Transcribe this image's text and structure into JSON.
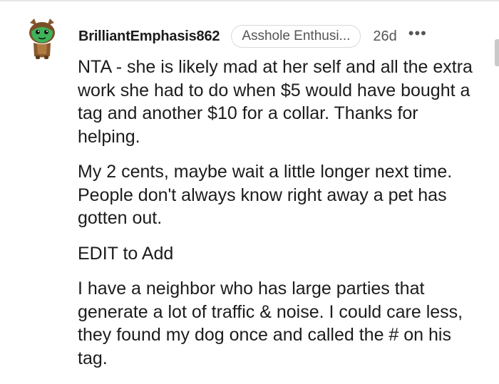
{
  "comment": {
    "author": "BrilliantEmphasis862",
    "flair": "Asshole Enthusi...",
    "age": "26d",
    "more_icon": "more-dots-icon",
    "avatar_icon": "snoo-avatar-icon",
    "paragraphs": [
      "NTA - she is likely mad at her self and all the extra work she had to do when $5 would have bought a tag and another $10 for a collar. Thanks for helping.",
      "My 2 cents, maybe wait a little longer next time. People don't always know right away a pet has gotten out.",
      "EDIT to Add",
      "I have a neighbor who has large parties that generate a lot of traffic & noise. I could care less, they found my dog once and called the # on his tag."
    ]
  },
  "colors": {
    "text": "#1c1c1c",
    "meta": "#555555",
    "avatar_green": "#3fb25a",
    "avatar_brown": "#8a5a2e"
  }
}
